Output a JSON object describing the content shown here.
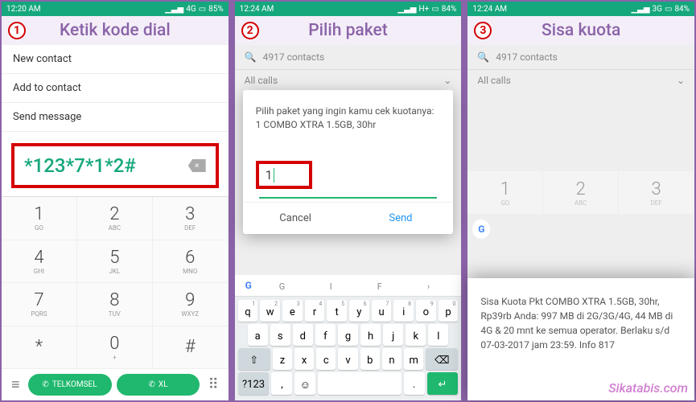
{
  "screen1": {
    "time": "12:20 AM",
    "network": "4G",
    "battery": "85%",
    "step": "1",
    "title": "Ketik kode dial",
    "menu": [
      "New contact",
      "Add to contact",
      "Send message"
    ],
    "dial_code": "*123*7*1*2#",
    "keys": [
      {
        "n": "1",
        "l": "GO"
      },
      {
        "n": "2",
        "l": "ABC"
      },
      {
        "n": "3",
        "l": "DEF"
      },
      {
        "n": "4",
        "l": "GHI"
      },
      {
        "n": "5",
        "l": "JKL"
      },
      {
        "n": "6",
        "l": "MNO"
      },
      {
        "n": "7",
        "l": "PQRS"
      },
      {
        "n": "8",
        "l": "TUV"
      },
      {
        "n": "9",
        "l": "WXYZ"
      },
      {
        "n": "*",
        "l": ""
      },
      {
        "n": "0",
        "l": "+"
      },
      {
        "n": "#",
        "l": ""
      }
    ],
    "call1": "TELKOMSEL",
    "call2": "XL"
  },
  "screen2": {
    "time": "12:24 AM",
    "network": "H+",
    "battery": "84%",
    "step": "2",
    "title": "Pilih paket",
    "search": "4917 contacts",
    "filter": "All calls",
    "popup_text": "Pilih paket yang ingin kamu cek kuotanya:\n1 COMBO XTRA 1.5GB, 30hr",
    "input_val": "1",
    "cancel": "Cancel",
    "send": "Send",
    "kb_row1": [
      {
        "k": "q",
        "s": "1"
      },
      {
        "k": "w",
        "s": "2"
      },
      {
        "k": "e",
        "s": "3"
      },
      {
        "k": "r",
        "s": "4"
      },
      {
        "k": "t",
        "s": "5"
      },
      {
        "k": "y",
        "s": "6"
      },
      {
        "k": "u",
        "s": "7"
      },
      {
        "k": "i",
        "s": "8"
      },
      {
        "k": "o",
        "s": "9"
      },
      {
        "k": "p",
        "s": "0"
      }
    ],
    "kb_row2": [
      "a",
      "s",
      "d",
      "f",
      "g",
      "h",
      "j",
      "k",
      "l"
    ],
    "kb_row3": [
      "z",
      "x",
      "c",
      "v",
      "b",
      "n",
      "m"
    ],
    "sym": "?123",
    "quick": [
      "G",
      "I",
      "F",
      ">"
    ]
  },
  "screen3": {
    "time": "12:24 AM",
    "network": "3G",
    "battery": "84%",
    "step": "3",
    "title": "Sisa kuota",
    "search": "4917 contacts",
    "filter": "All calls",
    "keys": [
      {
        "n": "1",
        "l": "GO"
      },
      {
        "n": "2",
        "l": "ABC"
      },
      {
        "n": "3",
        "l": "DEF"
      }
    ],
    "result": "Sisa Kuota Pkt  COMBO XTRA 1.5GB, 30hr, Rp39rb Anda: 997 MB di 2G/3G/4G,  44 MB di 4G & 20 mnt  ke semua operator. Berlaku s/d 07-03-2017 jam 23:59. Info 817",
    "watermark": "Sikatabis.com"
  },
  "icons": {
    "signal": "▬",
    "alarm": "⏰"
  }
}
